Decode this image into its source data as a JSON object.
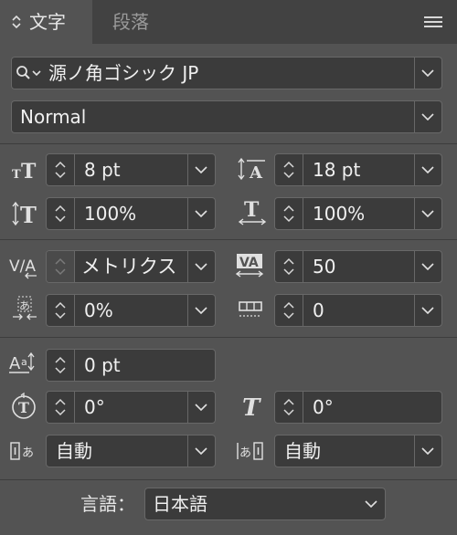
{
  "panel": {
    "tabs": [
      {
        "label": "文字",
        "active": true
      },
      {
        "label": "段落",
        "active": false
      }
    ],
    "tab_prefix_icon": "up-down-arrows-icon",
    "menu_icon": "panel-menu-icon"
  },
  "font": {
    "family": "源ノ角ゴシック JP",
    "style": "Normal"
  },
  "size": "8 pt",
  "leading": "18 pt",
  "vertical_scale": "100%",
  "horizontal_scale": "100%",
  "kerning": "メトリクス",
  "tracking": "50",
  "tsume": "0%",
  "aki": "0",
  "baseline_shift": "0 pt",
  "rotation": "0°",
  "skew": "0°",
  "mojikumi_before": "自動",
  "mojikumi_after": "自動",
  "language": {
    "label": "言語：",
    "value": "日本語"
  },
  "colors": {
    "panel_bg": "#535353",
    "tabbar_bg": "#424242",
    "field_bg": "#3b3b3b",
    "field_border": "#686868"
  }
}
